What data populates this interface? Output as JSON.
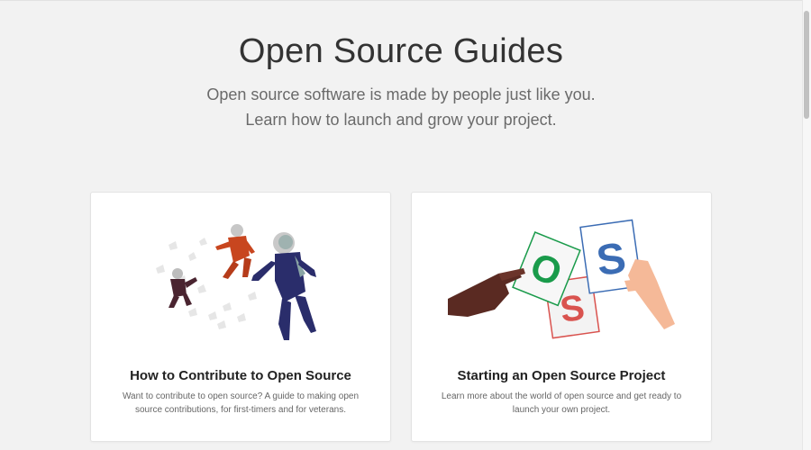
{
  "hero": {
    "title": "Open Source Guides",
    "subtitle_line1": "Open source software is made by people just like you.",
    "subtitle_line2": "Learn how to launch and grow your project."
  },
  "cards": [
    {
      "title": "How to Contribute to Open Source",
      "description": "Want to contribute to open source? A guide to making open source contributions, for first-timers and for veterans.",
      "illustration": "astronauts-illustration"
    },
    {
      "title": "Starting an Open Source Project",
      "description": "Learn more about the world of open source and get ready to launch your own project.",
      "illustration": "oss-cards-illustration",
      "card_letters": [
        "O",
        "S",
        "S"
      ]
    }
  ],
  "colors": {
    "background": "#f2f2f2",
    "card_bg": "#ffffff",
    "letter_green": "#1a9b4b",
    "letter_red": "#d9534f",
    "letter_blue": "#3b6cb4",
    "astronaut_navy": "#2a2d6b",
    "astronaut_orange": "#c8461f"
  }
}
